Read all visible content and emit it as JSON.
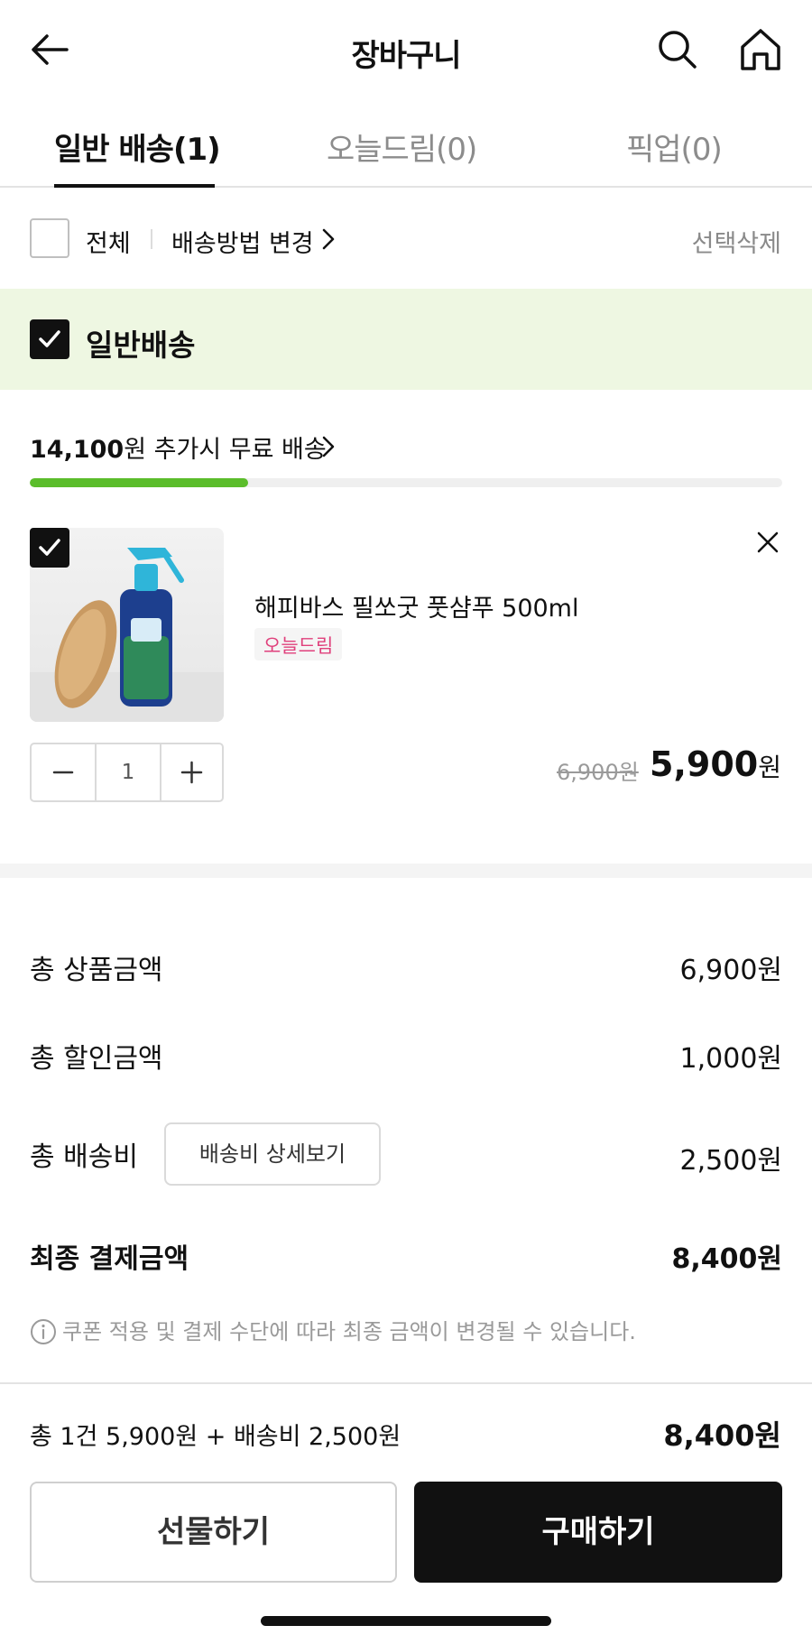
{
  "header": {
    "title": "장바구니",
    "back_icon": "arrow-left-icon",
    "search_icon": "search-icon",
    "home_icon": "home-icon"
  },
  "tabs": [
    {
      "label": "일반 배송(1)",
      "active": true
    },
    {
      "label": "오늘드림(0)",
      "active": false
    },
    {
      "label": "픽업(0)",
      "active": false
    }
  ],
  "select_row": {
    "all_label": "전체",
    "method_label": "배송방법 변경",
    "delete_label": "선택삭제"
  },
  "group": {
    "label": "일반배송",
    "free_shipping": {
      "amount": "14,100",
      "text": "원 추가시 무료 배송",
      "progress": 0.29
    }
  },
  "product": {
    "name": "해피바스 필쏘굿 풋샴푸 500ml",
    "badge": "오늘드림",
    "quantity": "1",
    "original_price": "6,900원",
    "price": "5,900",
    "price_unit": "원"
  },
  "summary": {
    "total_product_label": "총 상품금액",
    "total_product_value": "6,900원",
    "total_discount_label": "총 할인금액",
    "total_discount_value": "1,000원",
    "shipping_label": "총 배송비",
    "shipping_detail_button": "배송비 상세보기",
    "shipping_value": "2,500원",
    "final_label": "최종 결제금액",
    "final_value": "8,400원",
    "notice": "쿠폰 적용 및 결제 수단에 따라 최종 금액이 변경될 수 있습니다."
  },
  "bottom": {
    "summary_text": "총 1건 5,900원 + 배송비 2,500원",
    "total": "8,400원",
    "gift_button": "선물하기",
    "buy_button": "구매하기"
  },
  "colors": {
    "accent_green": "#5bbd2b",
    "group_bg": "#eef7e2",
    "badge_pink": "#e0407c",
    "primary_dark": "#111111"
  }
}
